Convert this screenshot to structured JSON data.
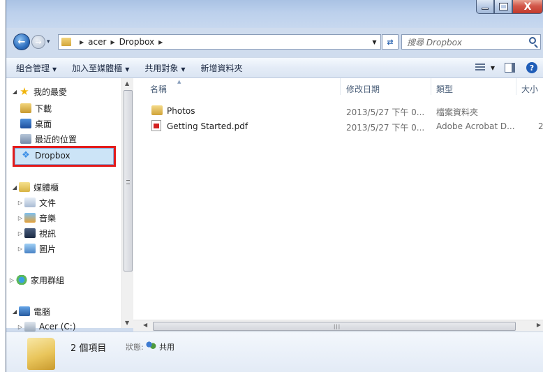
{
  "window": {
    "minimize_icon": "minimize-icon",
    "maximize_icon": "maximize-icon",
    "close_label": "X"
  },
  "address": {
    "crumbs": [
      "acer",
      "Dropbox"
    ],
    "search_placeholder": "搜尋 Dropbox"
  },
  "toolbar": {
    "organize": "組合管理",
    "add_to_library": "加入至媒體櫃",
    "share_with": "共用對象",
    "new_folder": "新增資料夾"
  },
  "navpane": {
    "favorites": "我的最愛",
    "downloads": "下載",
    "desktop": "桌面",
    "recent": "最近的位置",
    "dropbox": "Dropbox",
    "libraries": "媒體櫃",
    "documents": "文件",
    "music": "音樂",
    "videos": "視訊",
    "pictures": "圖片",
    "homegroup": "家用群組",
    "computer": "電腦",
    "drive_c": "Acer (C:)"
  },
  "columns": {
    "name": "名稱",
    "date": "修改日期",
    "type": "類型",
    "size": "大小"
  },
  "files": [
    {
      "name": "Photos",
      "date": "2013/5/27 下午 0...",
      "type": "檔案資料夾",
      "size": "",
      "icon": "folder-icon"
    },
    {
      "name": "Getting Started.pdf",
      "date": "2013/5/27 下午 0...",
      "type": "Adobe Acrobat D...",
      "size": "2",
      "icon": "pdf-icon"
    }
  ],
  "details": {
    "count": "2 個項目",
    "status_label": "狀態:",
    "status": "共用"
  }
}
